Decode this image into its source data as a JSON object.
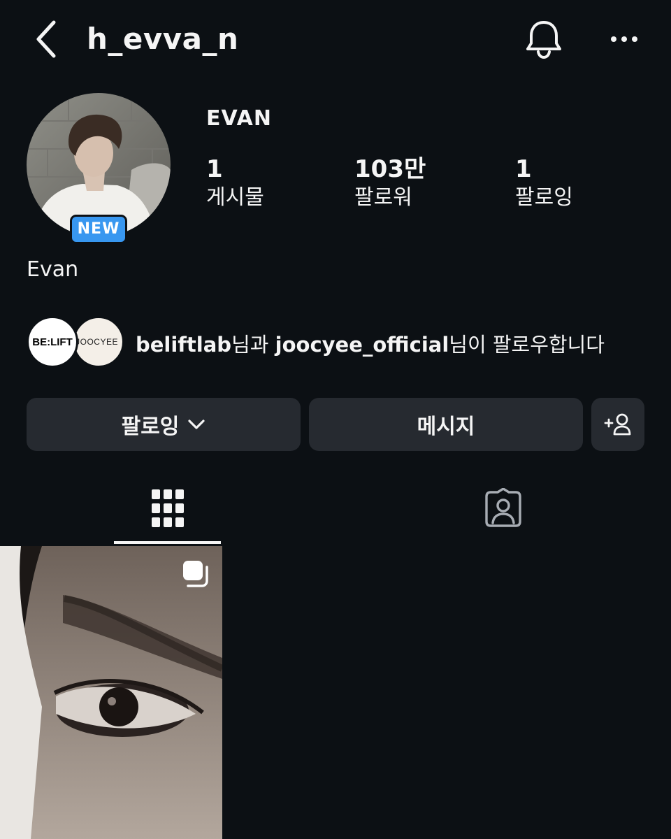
{
  "header": {
    "username": "h_evva_n",
    "back_icon": "chevron-left-icon",
    "notifications_icon": "bell-icon",
    "more_icon": "more-horizontal-icon"
  },
  "profile": {
    "display_name": "EVAN",
    "badge": "NEW",
    "full_name": "Evan",
    "stats": [
      {
        "value": "1",
        "label": "게시물"
      },
      {
        "value": "103만",
        "label": "팔로워"
      },
      {
        "value": "1",
        "label": "팔로잉"
      }
    ]
  },
  "followed_by": {
    "avatars": [
      {
        "text": "BE:LIFT"
      },
      {
        "text": "JOOCYEE"
      }
    ],
    "user1": "beliftlab",
    "joiner": "님과 ",
    "user2": "joocyee_official",
    "suffix": "님이 팔로우합니다"
  },
  "actions": {
    "following_label": "팔로잉",
    "message_label": "메시지",
    "add_user_icon": "person-add-icon"
  },
  "tabs": [
    {
      "icon": "grid-icon",
      "active": true
    },
    {
      "icon": "tagged-person-icon",
      "active": false
    }
  ],
  "posts": [
    {
      "type": "carousel",
      "icon": "multiple-posts-icon"
    }
  ],
  "colors": {
    "background": "#0c1014",
    "button": "#262a30",
    "badge": "#3897f0",
    "text": "#f5f5f5"
  }
}
